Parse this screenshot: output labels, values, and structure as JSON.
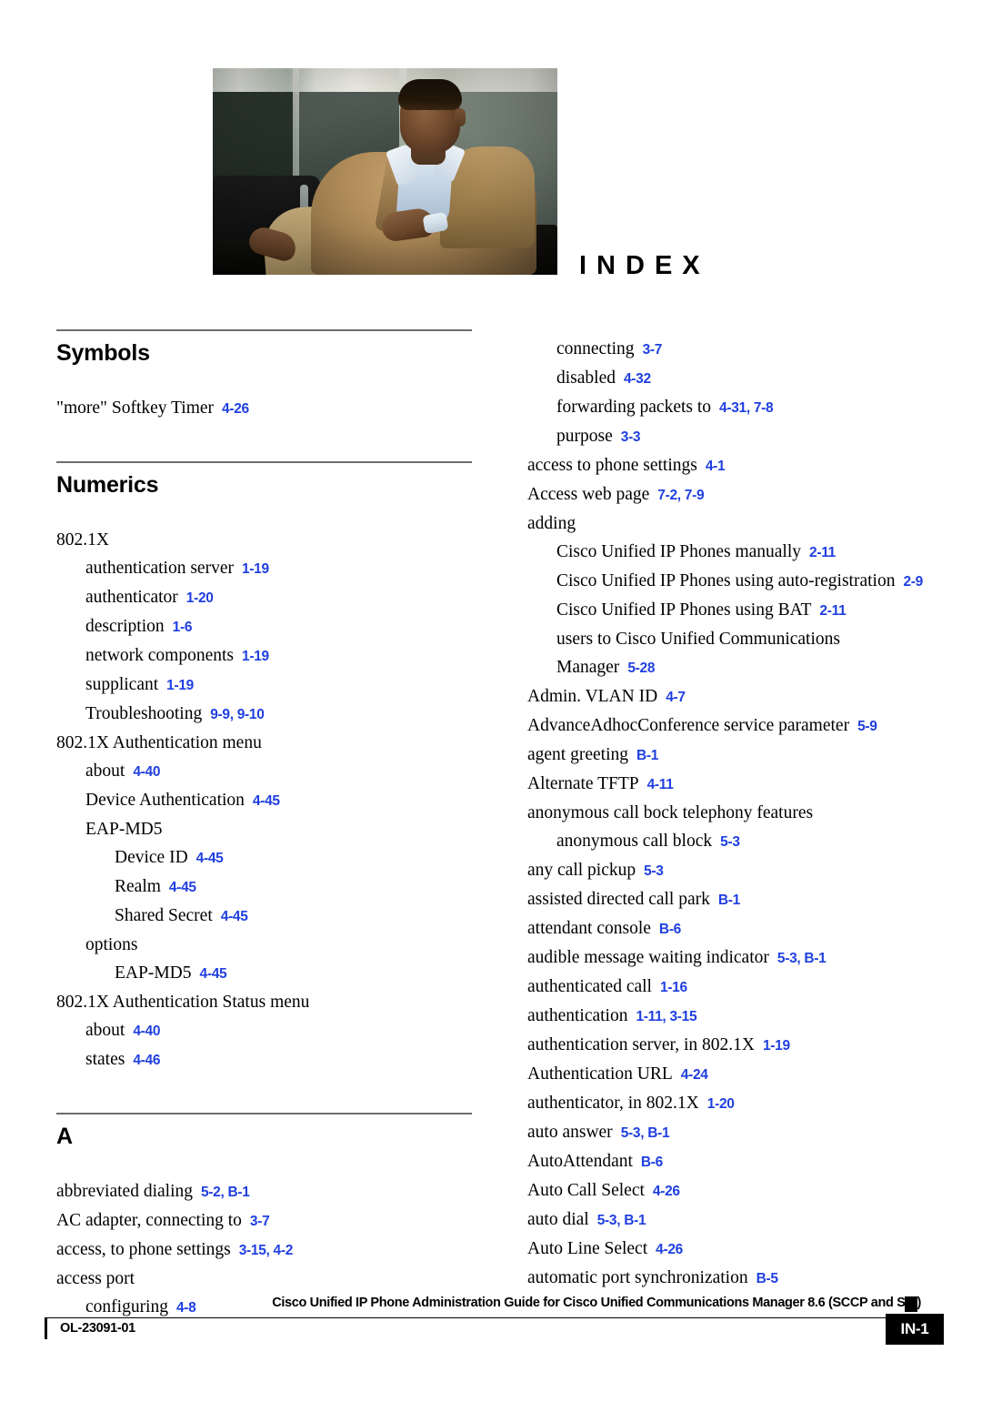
{
  "document": {
    "heading": "INDEX",
    "photo_alt": "seated-man-in-tan-jacket-photo"
  },
  "footer": {
    "title": "Cisco Unified IP Phone Administration Guide for Cisco Unified Communications Manager 8.6 (SCCP and SIP)",
    "doc_id": "OL-23091-01",
    "page_number": "IN-1"
  },
  "colors": {
    "page_reference": "#1f3fe0",
    "rule": "#6d6d6d",
    "text": "#000000"
  },
  "left_column": {
    "sections": [
      {
        "heading": "Symbols",
        "entries": [
          {
            "level": 0,
            "text": "\"more\" Softkey Timer",
            "refs": "4-26"
          }
        ]
      },
      {
        "heading": "Numerics",
        "entries": [
          {
            "level": 0,
            "text": "802.1X",
            "refs": ""
          },
          {
            "level": 1,
            "text": "authentication server",
            "refs": "1-19"
          },
          {
            "level": 1,
            "text": "authenticator",
            "refs": "1-20"
          },
          {
            "level": 1,
            "text": "description",
            "refs": "1-6"
          },
          {
            "level": 1,
            "text": "network components",
            "refs": "1-19"
          },
          {
            "level": 1,
            "text": "supplicant",
            "refs": "1-19"
          },
          {
            "level": 1,
            "text": "Troubleshooting",
            "refs": "9-9, 9-10"
          },
          {
            "level": 0,
            "text": "802.1X Authentication menu",
            "refs": ""
          },
          {
            "level": 1,
            "text": "about",
            "refs": "4-40"
          },
          {
            "level": 1,
            "text": "Device Authentication",
            "refs": "4-45"
          },
          {
            "level": 1,
            "text": "EAP-MD5",
            "refs": ""
          },
          {
            "level": 2,
            "text": "Device ID",
            "refs": "4-45"
          },
          {
            "level": 2,
            "text": "Realm",
            "refs": "4-45"
          },
          {
            "level": 2,
            "text": "Shared Secret",
            "refs": "4-45"
          },
          {
            "level": 1,
            "text": "options",
            "refs": ""
          },
          {
            "level": 2,
            "text": "EAP-MD5",
            "refs": "4-45"
          },
          {
            "level": 0,
            "text": "802.1X Authentication Status menu",
            "refs": ""
          },
          {
            "level": 1,
            "text": "about",
            "refs": "4-40"
          },
          {
            "level": 1,
            "text": "states",
            "refs": "4-46"
          }
        ]
      },
      {
        "heading": "A",
        "entries": [
          {
            "level": 0,
            "text": "abbreviated dialing",
            "refs": "5-2, B-1"
          },
          {
            "level": 0,
            "text": "AC adapter, connecting to",
            "refs": "3-7"
          },
          {
            "level": 0,
            "text": "access, to phone settings",
            "refs": "3-15, 4-2"
          },
          {
            "level": 0,
            "text": "access port",
            "refs": ""
          },
          {
            "level": 1,
            "text": "configuring",
            "refs": "4-8"
          }
        ]
      }
    ]
  },
  "right_column": {
    "entries": [
      {
        "level": 1,
        "text": "connecting",
        "refs": "3-7"
      },
      {
        "level": 1,
        "text": "disabled",
        "refs": "4-32"
      },
      {
        "level": 1,
        "text": "forwarding packets to",
        "refs": "4-31, 7-8"
      },
      {
        "level": 1,
        "text": "purpose",
        "refs": "3-3"
      },
      {
        "level": 0,
        "text": "access to phone settings",
        "refs": "4-1"
      },
      {
        "level": 0,
        "text": "Access web page",
        "refs": "7-2, 7-9"
      },
      {
        "level": 0,
        "text": "adding",
        "refs": ""
      },
      {
        "level": 1,
        "text": "Cisco Unified IP Phones manually",
        "refs": "2-11"
      },
      {
        "level": 1,
        "text": "Cisco Unified IP Phones using auto-registration",
        "refs": "2-9"
      },
      {
        "level": 1,
        "text": "Cisco Unified IP Phones using BAT",
        "refs": "2-11"
      },
      {
        "level": 1,
        "text": "users to Cisco Unified Communications Manager",
        "refs": "5-28",
        "wrap": true
      },
      {
        "level": 0,
        "text": "Admin. VLAN ID",
        "refs": "4-7"
      },
      {
        "level": 0,
        "text": "AdvanceAdhocConference service parameter",
        "refs": "5-9"
      },
      {
        "level": 0,
        "text": "agent greeting",
        "refs": "B-1"
      },
      {
        "level": 0,
        "text": "Alternate TFTP",
        "refs": "4-11"
      },
      {
        "level": 0,
        "text": "anonymous call bock telephony features",
        "refs": ""
      },
      {
        "level": 1,
        "text": "anonymous call block",
        "refs": "5-3"
      },
      {
        "level": 0,
        "text": "any call pickup",
        "refs": "5-3"
      },
      {
        "level": 0,
        "text": "assisted directed call park",
        "refs": "B-1"
      },
      {
        "level": 0,
        "text": "attendant console",
        "refs": "B-6"
      },
      {
        "level": 0,
        "text": "audible message waiting indicator",
        "refs": "5-3, B-1"
      },
      {
        "level": 0,
        "text": "authenticated call",
        "refs": "1-16"
      },
      {
        "level": 0,
        "text": "authentication",
        "refs": "1-11, 3-15"
      },
      {
        "level": 0,
        "text": "authentication server, in 802.1X",
        "refs": "1-19"
      },
      {
        "level": 0,
        "text": "Authentication URL",
        "refs": "4-24"
      },
      {
        "level": 0,
        "text": "authenticator, in 802.1X",
        "refs": "1-20"
      },
      {
        "level": 0,
        "text": "auto answer",
        "refs": "5-3, B-1"
      },
      {
        "level": 0,
        "text": "AutoAttendant",
        "refs": "B-6"
      },
      {
        "level": 0,
        "text": "Auto Call Select",
        "refs": "4-26"
      },
      {
        "level": 0,
        "text": "auto dial",
        "refs": "5-3, B-1"
      },
      {
        "level": 0,
        "text": "Auto Line Select",
        "refs": "4-26"
      },
      {
        "level": 0,
        "text": "automatic port synchronization",
        "refs": "B-5"
      }
    ]
  }
}
